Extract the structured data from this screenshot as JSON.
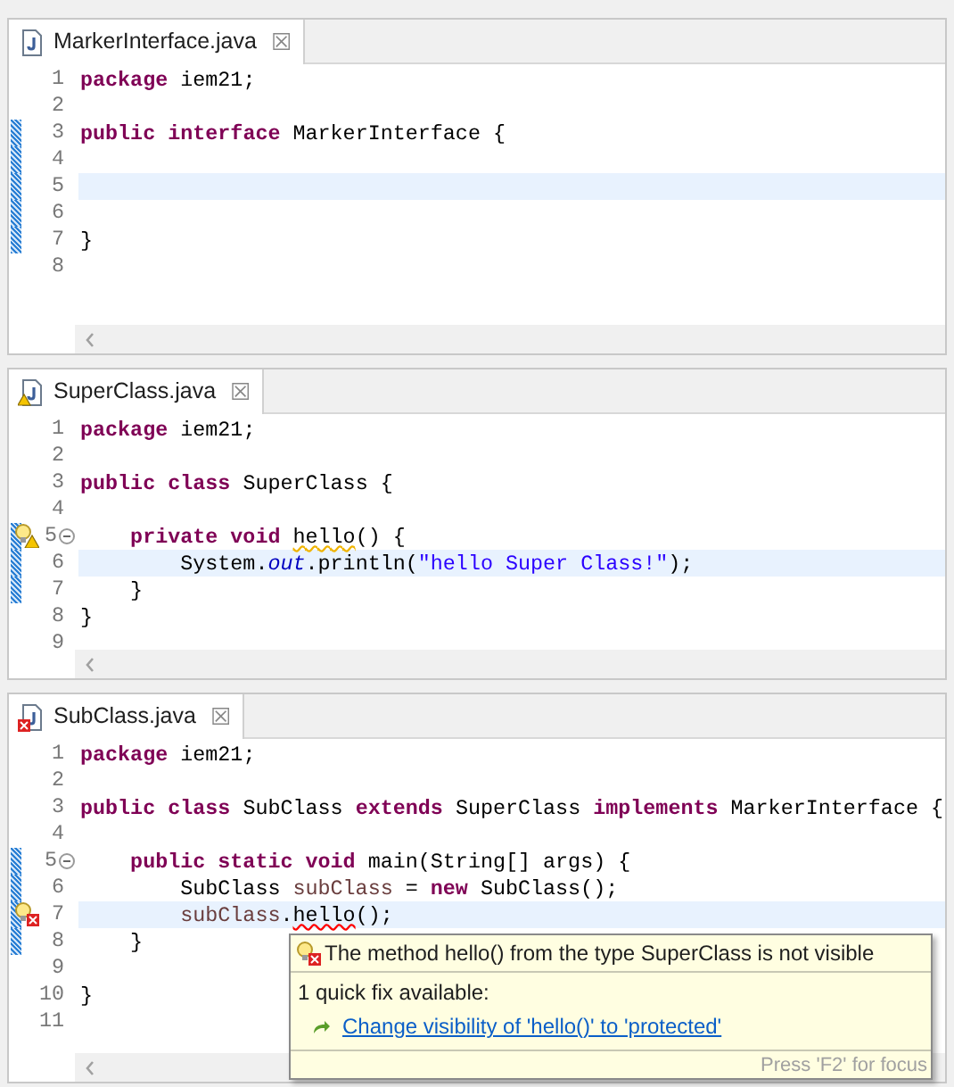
{
  "editors": [
    {
      "tab": {
        "title": "MarkerInterface.java",
        "has_warning": false,
        "has_error": false,
        "close": "☒"
      },
      "lines": [
        {
          "number": "1",
          "changed": false,
          "current": false,
          "tokens": [
            {
              "kind": "keyword",
              "text": "package"
            },
            {
              "kind": "plain",
              "text": " iem21;"
            }
          ]
        },
        {
          "number": "2",
          "changed": false,
          "current": false
        },
        {
          "number": "3",
          "changed": true,
          "current": false,
          "tokens": [
            {
              "kind": "keyword",
              "text": "public "
            },
            {
              "kind": "keyword",
              "text": "interface"
            },
            {
              "kind": "plain",
              "text": " MarkerInterface {"
            }
          ]
        },
        {
          "number": "4",
          "changed": true,
          "current": false
        },
        {
          "number": "5",
          "changed": true,
          "current": true
        },
        {
          "number": "6",
          "changed": true,
          "current": false
        },
        {
          "number": "7",
          "changed": true,
          "current": false,
          "tokens": [
            {
              "kind": "plain",
              "text": "}"
            }
          ]
        },
        {
          "number": "8",
          "changed": false,
          "current": false
        }
      ]
    },
    {
      "tab": {
        "title": "SuperClass.java",
        "has_warning": true,
        "has_error": false,
        "close": "☒"
      },
      "lines": [
        {
          "number": "1",
          "changed": false,
          "current": false,
          "tokens": [
            {
              "kind": "keyword",
              "text": "package"
            },
            {
              "kind": "plain",
              "text": " iem21;"
            }
          ]
        },
        {
          "number": "2",
          "changed": false,
          "current": false
        },
        {
          "number": "3",
          "changed": false,
          "current": false,
          "tokens": [
            {
              "kind": "keyword",
              "text": "public "
            },
            {
              "kind": "keyword",
              "text": "class"
            },
            {
              "kind": "plain",
              "text": " SuperClass {"
            }
          ]
        },
        {
          "number": "4",
          "changed": false,
          "current": false
        },
        {
          "number": "5",
          "changed": true,
          "current": false,
          "warning_marker": true,
          "fold": true,
          "tokens": [
            {
              "kind": "keyword",
              "text": "    private "
            },
            {
              "kind": "keyword",
              "text": "void "
            },
            {
              "kind": "warn",
              "text": "hello"
            },
            {
              "kind": "plain",
              "text": "() {"
            }
          ]
        },
        {
          "number": "6",
          "changed": true,
          "current": true,
          "tokens": [
            {
              "kind": "plain",
              "text": "        System."
            },
            {
              "kind": "field",
              "text": "out"
            },
            {
              "kind": "plain",
              "text": ".println("
            },
            {
              "kind": "string",
              "text": "\"hello Super Class!\""
            },
            {
              "kind": "plain",
              "text": ");"
            }
          ]
        },
        {
          "number": "7",
          "changed": true,
          "current": false,
          "tokens": [
            {
              "kind": "plain",
              "text": "    }"
            }
          ]
        },
        {
          "number": "8",
          "changed": false,
          "current": false,
          "tokens": [
            {
              "kind": "plain",
              "text": "}"
            }
          ]
        },
        {
          "number": "9",
          "changed": false,
          "current": false
        }
      ]
    },
    {
      "tab": {
        "title": "SubClass.java",
        "has_warning": false,
        "has_error": true,
        "close": "☒"
      },
      "lines": [
        {
          "number": "1",
          "changed": false,
          "current": false,
          "tokens": [
            {
              "kind": "keyword",
              "text": "package"
            },
            {
              "kind": "plain",
              "text": " iem21;"
            }
          ]
        },
        {
          "number": "2",
          "changed": false,
          "current": false
        },
        {
          "number": "3",
          "changed": false,
          "current": false,
          "tokens": [
            {
              "kind": "keyword",
              "text": "public "
            },
            {
              "kind": "keyword",
              "text": "class"
            },
            {
              "kind": "plain",
              "text": " SubClass "
            },
            {
              "kind": "keyword",
              "text": "extends"
            },
            {
              "kind": "plain",
              "text": " SuperClass "
            },
            {
              "kind": "keyword",
              "text": "implements"
            },
            {
              "kind": "plain",
              "text": " MarkerInterface {"
            }
          ]
        },
        {
          "number": "4",
          "changed": false,
          "current": false
        },
        {
          "number": "5",
          "changed": true,
          "current": false,
          "fold": true,
          "tokens": [
            {
              "kind": "keyword",
              "text": "    public "
            },
            {
              "kind": "keyword",
              "text": "static "
            },
            {
              "kind": "keyword",
              "text": "void"
            },
            {
              "kind": "plain",
              "text": " main(String[] args) {"
            }
          ]
        },
        {
          "number": "6",
          "changed": true,
          "current": false,
          "tokens": [
            {
              "kind": "plain",
              "text": "        SubClass "
            },
            {
              "kind": "local",
              "text": "subClass"
            },
            {
              "kind": "plain",
              "text": " = "
            },
            {
              "kind": "keyword",
              "text": "new"
            },
            {
              "kind": "plain",
              "text": " SubClass();"
            }
          ]
        },
        {
          "number": "7",
          "changed": true,
          "current": true,
          "error_marker": true,
          "tokens": [
            {
              "kind": "local",
              "text": "        subClass"
            },
            {
              "kind": "plain",
              "text": "."
            },
            {
              "kind": "error",
              "text": "hello"
            },
            {
              "kind": "plain",
              "text": "();"
            }
          ]
        },
        {
          "number": "8",
          "changed": true,
          "current": false,
          "tokens": [
            {
              "kind": "plain",
              "text": "    }"
            }
          ]
        },
        {
          "number": "9",
          "changed": false,
          "current": false
        },
        {
          "number": "10",
          "changed": false,
          "current": false,
          "tokens": [
            {
              "kind": "plain",
              "text": "}"
            }
          ]
        },
        {
          "number": "11",
          "changed": false,
          "current": false
        }
      ],
      "hover": {
        "message": "The method hello() from the type SuperClass is not visible",
        "fixes_heading": "1 quick fix available:",
        "fixes": [
          {
            "label": "Change visibility of 'hello()' to 'protected'"
          }
        ],
        "footer": "Press 'F2' for focus"
      }
    }
  ]
}
